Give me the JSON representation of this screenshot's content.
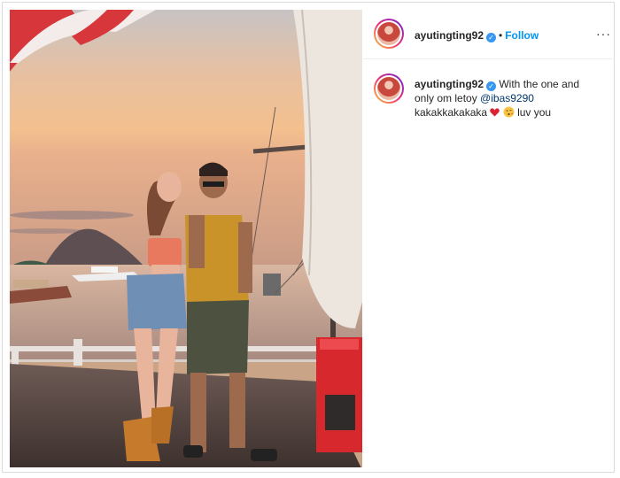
{
  "post": {
    "username": "ayutingting92",
    "follow_label": "Follow",
    "separator": "•",
    "more_label": "···",
    "verified_glyph": "✓"
  },
  "caption": {
    "username": "ayutingting92",
    "text_part1": "With the one and only om letoy",
    "mention": "@ibas9290",
    "text_part2": "kakakkakakaka",
    "emoji_1": "red-heart",
    "emoji_2": "kissing-face",
    "text_part3": "luv you"
  },
  "colors": {
    "follow_blue": "#0095f6",
    "mention_blue": "#00376b",
    "verified_blue": "#3897f0"
  }
}
